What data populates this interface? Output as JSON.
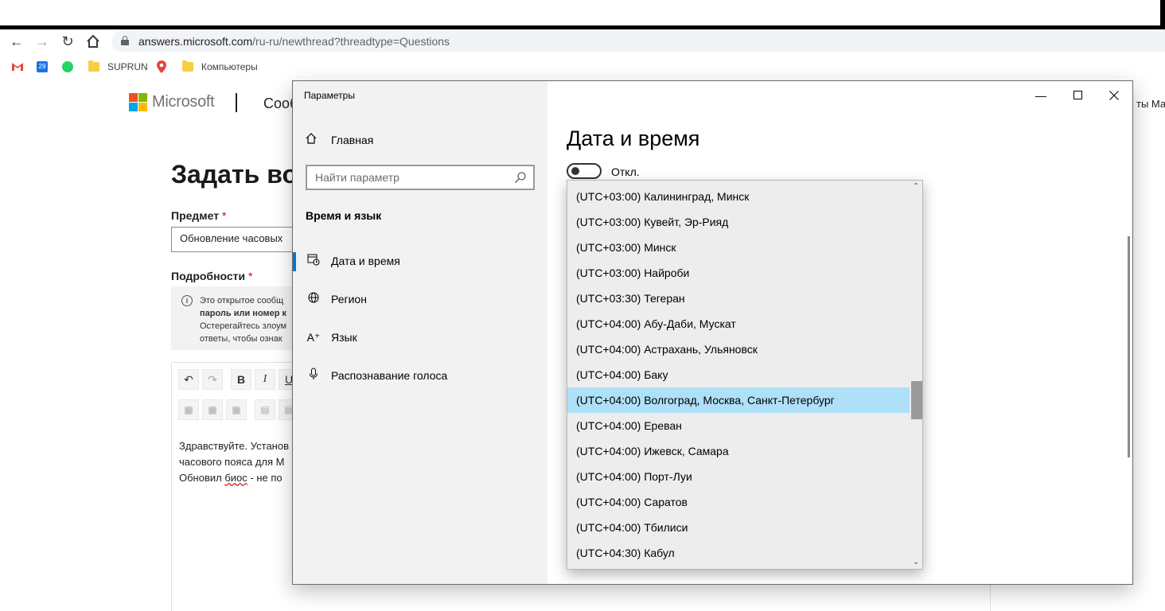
{
  "browser": {
    "url_host": "answers.microsoft.com",
    "url_path": "/ru-ru/newthread?threadtype=Questions",
    "bookmarks": [
      {
        "label": "SUPRUN"
      },
      {
        "label": "Компьютеры"
      }
    ]
  },
  "page": {
    "brand": "Microsoft",
    "section": "Сооб",
    "right_link": "ты Ма",
    "heading": "Задать во",
    "subject_label": "Предмет",
    "subject_value": "Обновление часовых",
    "details_label": "Подробности",
    "required_mark": "*",
    "notice_line1": "Это открытое сообщ",
    "notice_line2": "пароль или номер к",
    "notice_line3": "Остерегайтесь злоум",
    "notice_line4": "ответы, чтобы ознак",
    "editor_line1": "Здравствуйте. Установ",
    "editor_line2": "часового пояса для М",
    "editor_line3_a": "Обновил ",
    "editor_line3_b": "биос",
    "editor_line3_c": " - не по"
  },
  "settings": {
    "window_title": "Параметры",
    "home_label": "Главная",
    "search_placeholder": "Найти параметр",
    "section_heading": "Время и язык",
    "nav_items": [
      {
        "label": "Дата и время",
        "icon": "calendar-clock-icon",
        "selected": true
      },
      {
        "label": "Регион",
        "icon": "globe-icon",
        "selected": false
      },
      {
        "label": "Язык",
        "icon": "language-icon",
        "selected": false
      },
      {
        "label": "Распознавание голоса",
        "icon": "microphone-icon",
        "selected": false
      }
    ],
    "page_title": "Дата и время",
    "toggle_label": "Откл.",
    "timezones": [
      "(UTC+03:00) Калининград, Минск",
      "(UTC+03:00) Кувейт, Эр-Рияд",
      "(UTC+03:00) Минск",
      "(UTC+03:00) Найроби",
      "(UTC+03:30) Тегеран",
      "(UTC+04:00) Абу-Даби, Мускат",
      "(UTC+04:00) Астрахань, Ульяновск",
      "(UTC+04:00) Баку",
      "(UTC+04:00) Волгоград, Москва, Санкт-Петербург",
      "(UTC+04:00) Ереван",
      "(UTC+04:00) Ижевск, Самара",
      "(UTC+04:00) Порт-Луи",
      "(UTC+04:00) Саратов",
      "(UTC+04:00) Тбилиси",
      "(UTC+04:30) Кабул"
    ],
    "selected_timezone": "(UTC+04:00) Волгоград, Москва, Санкт-Петербург"
  },
  "colors": {
    "accent": "#0078d4",
    "selection": "#aee0f8",
    "sidebar_bg": "#f2f2f2"
  }
}
